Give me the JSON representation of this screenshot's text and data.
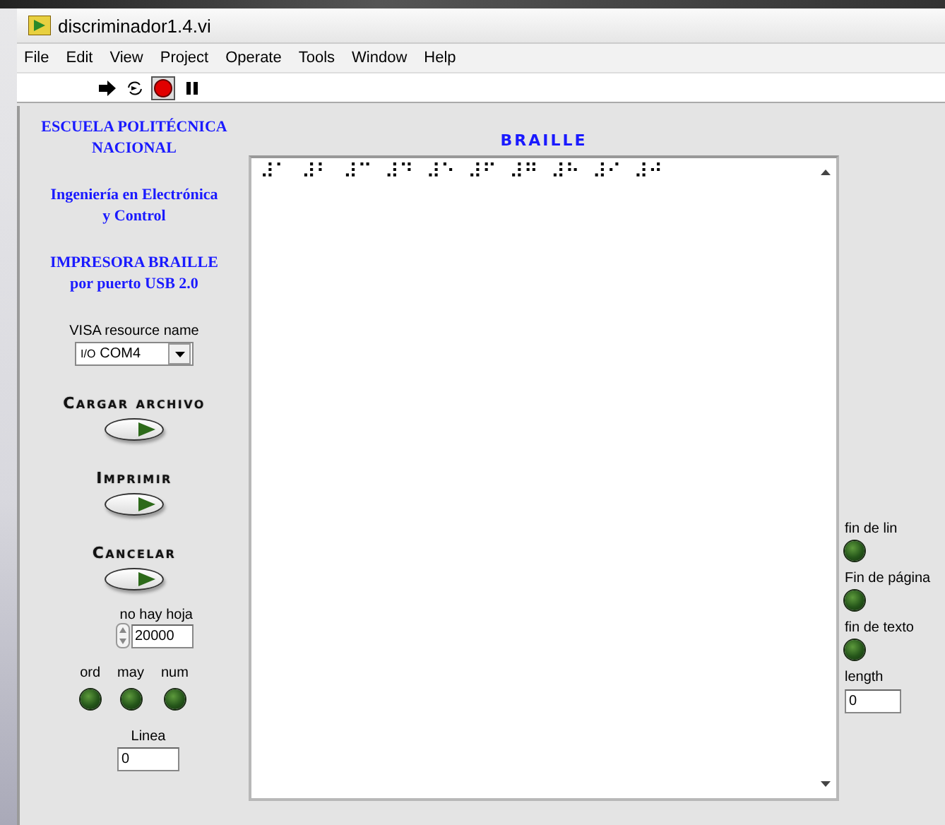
{
  "window": {
    "title": "discriminador1.4.vi"
  },
  "menu": [
    "File",
    "Edit",
    "View",
    "Project",
    "Operate",
    "Tools",
    "Window",
    "Help"
  ],
  "toolbar": [
    {
      "kind": "run",
      "pressed": false
    },
    {
      "kind": "run-continuous",
      "pressed": false
    },
    {
      "kind": "abort",
      "pressed": true
    },
    {
      "kind": "pause",
      "pressed": false
    }
  ],
  "headings": [
    {
      "lines": [
        "ESCUELA POLITÉCNICA",
        "NACIONAL"
      ]
    },
    {
      "lines": [
        "Ingeniería en Electrónica",
        "y Control"
      ]
    },
    {
      "lines": [
        "IMPRESORA BRAILLE",
        "por puerto USB 2.0"
      ]
    }
  ],
  "visa": {
    "label": "VISA resource name",
    "prefix": "I/O",
    "value": "COM4"
  },
  "buttons": [
    {
      "label": "Cargar archivo"
    },
    {
      "label": "Imprimir"
    },
    {
      "label": "Cancelar"
    }
  ],
  "no_hay_hoja": {
    "label": "no hay hoja",
    "value": "20000"
  },
  "mode_leds": [
    {
      "label": "ord",
      "on": false
    },
    {
      "label": "may",
      "on": false
    },
    {
      "label": "num",
      "on": false
    }
  ],
  "linea": {
    "label": "Linea",
    "value": "0"
  },
  "braille": {
    "title": "BRAILLE",
    "text": "⠼⠁  ⠼⠃  ⠼⠉  ⠼⠙  ⠼⠑  ⠼⠋  ⠼⠛  ⠼⠓  ⠼⠊  ⠼⠚"
  },
  "status_leds": [
    {
      "label": "fin de lin",
      "on": false
    },
    {
      "label": "Fin de página",
      "on": false
    },
    {
      "label": "fin de texto",
      "on": false
    }
  ],
  "length": {
    "label": "length",
    "value": "0"
  }
}
